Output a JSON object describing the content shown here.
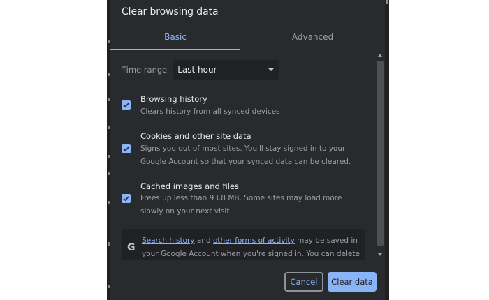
{
  "dialog": {
    "title": "Clear browsing data"
  },
  "tabs": [
    {
      "label": "Basic",
      "selected": true
    },
    {
      "label": "Advanced",
      "selected": false
    }
  ],
  "time_range": {
    "label": "Time range",
    "value": "Last hour"
  },
  "options": [
    {
      "title": "Browsing history",
      "description": "Clears history from all synced devices",
      "checked": true
    },
    {
      "title": "Cookies and other site data",
      "description": "Signs you out of most sites. You'll stay signed in to your Google Account so that your synced data can be cleared.",
      "checked": true
    },
    {
      "title": "Cached images and files",
      "description": "Frees up less than 93.8 MB. Some sites may load more slowly on your next visit.",
      "checked": true
    }
  ],
  "google_notice": {
    "icon": "G",
    "link1": "Search history",
    "text1": " and ",
    "link2": "other forms of activity",
    "text2": " may be saved in your Google Account when you're signed in. You can delete them at any time."
  },
  "buttons": {
    "cancel": "Cancel",
    "clear": "Clear data"
  },
  "colors": {
    "dialog_bg": "#292a2d",
    "accent": "#8ab4f8",
    "text_primary": "#e8eaed",
    "text_secondary": "#9aa0a6"
  }
}
